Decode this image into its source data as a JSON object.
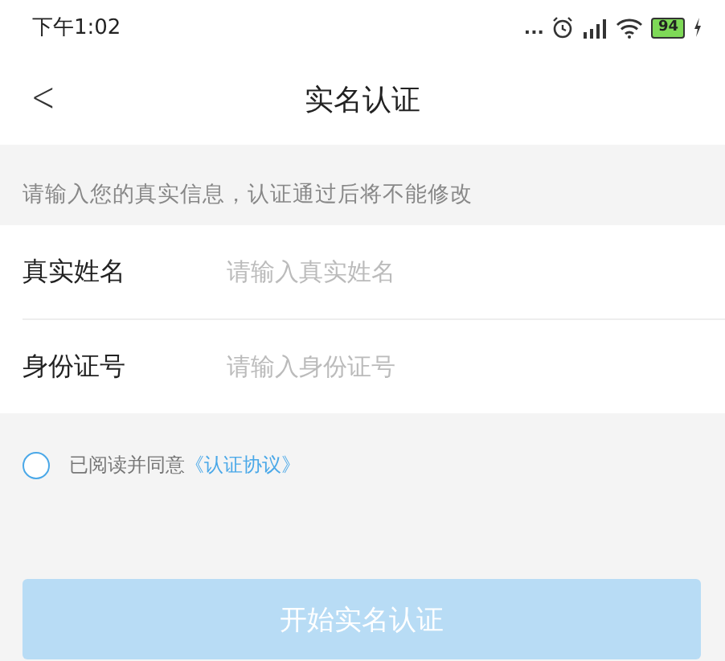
{
  "status_bar": {
    "time": "下午1:02",
    "more": "...",
    "battery": "94"
  },
  "header": {
    "back": "<",
    "title": "实名认证"
  },
  "notice": "请输入您的真实信息，认证通过后将不能修改",
  "fields": [
    {
      "label": "真实姓名",
      "placeholder": "请输入真实姓名"
    },
    {
      "label": "身份证号",
      "placeholder": "请输入身份证号"
    }
  ],
  "agreement": {
    "checked": false,
    "text": "已阅读并同意",
    "link": "《认证协议》"
  },
  "submit": {
    "label": "开始实名认证",
    "disabled": true
  }
}
